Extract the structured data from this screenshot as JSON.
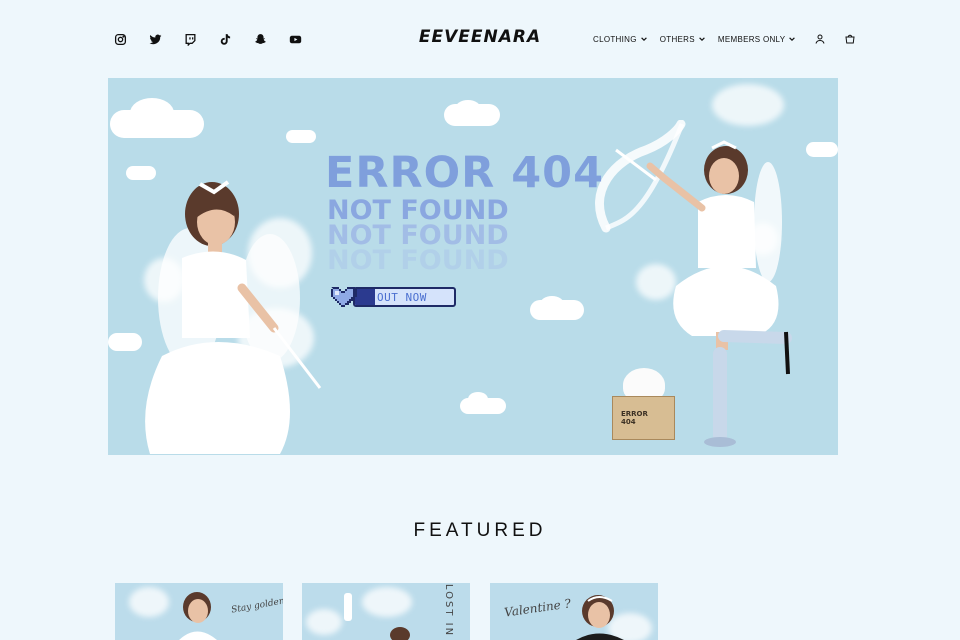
{
  "header": {
    "logo": "EEVEENARA",
    "socials": [
      "instagram-icon",
      "twitter-icon",
      "twitch-icon",
      "tiktok-icon",
      "snapchat-icon",
      "youtube-icon"
    ],
    "nav": {
      "clothing": "CLOTHING",
      "others": "OTHERS",
      "members": "MEMBERS ONLY"
    }
  },
  "hero": {
    "title": "ERROR 404",
    "subtitle": "NOT FOUND",
    "echo_1": "NOT FOUND",
    "echo_2": "NOT FOUND",
    "cta_label": "OUT NOW",
    "cta_progress": 0.2,
    "box_label_1": "ERROR",
    "box_label_2": "404"
  },
  "featured": {
    "title": "FEATURED",
    "cards": [
      {
        "text": "Stay golden"
      },
      {
        "text": "LOST IN"
      },
      {
        "text": "Valentine ?"
      }
    ]
  },
  "colors": {
    "background": "#eef7fc",
    "hero_sky": "#b9dce9",
    "title_blue": "#7f9fdc",
    "cta_navy": "#1e2a66"
  }
}
